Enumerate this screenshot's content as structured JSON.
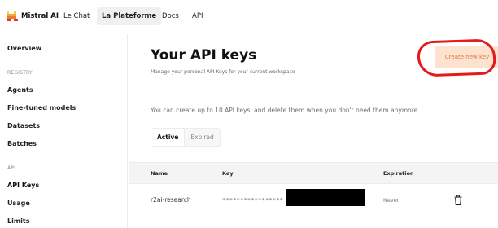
{
  "nav": {
    "brand": "Mistral AI",
    "links": [
      "Le Chat",
      "La Plateforme",
      "Docs",
      "API"
    ],
    "active_link": "La Plateforme"
  },
  "sidebar": {
    "overview": "Overview",
    "registry_label": "REGISTRY",
    "registry_items": [
      "Agents",
      "Fine-tuned models",
      "Datasets",
      "Batches"
    ],
    "api_label": "API",
    "api_items": [
      "API Keys",
      "Usage",
      "Limits"
    ],
    "active_item": "API Keys"
  },
  "main": {
    "title": "Your API keys",
    "subtitle": "Manage your personal API Keys for your current workspace",
    "create_button": "Create new key",
    "info": "You can create up to 10 API keys, and delete them when you don't need them anymore.",
    "tabs": [
      "Active",
      "Expired"
    ],
    "active_tab": "Active"
  },
  "table": {
    "headers": {
      "name": "Name",
      "key": "Key",
      "expiration": "Expiration"
    },
    "rows": [
      {
        "name": "r2ai-research",
        "key": "*****************",
        "expiration": "Never"
      }
    ]
  },
  "colors": {
    "accent": "#e07a3a",
    "button_bg": "#fde2cf",
    "highlight": "#e31b1b",
    "logo": [
      "#f7d046",
      "#f2a73b",
      "#ee792f",
      "#eb5829",
      "#ea3326"
    ]
  },
  "icons": {
    "logo": "mistral-logo-icon",
    "delete": "trash-icon"
  }
}
